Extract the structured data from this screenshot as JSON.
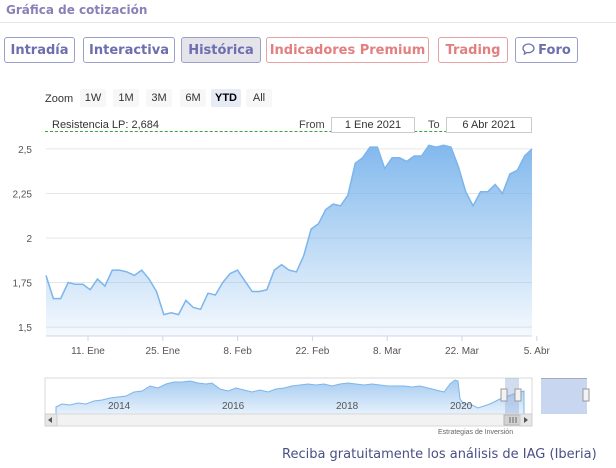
{
  "page": {
    "heading": "Gráfica de cotización",
    "footer": "Reciba gratuitamente los análisis de IAG (Iberia)"
  },
  "tabs": [
    {
      "label": "Intradía",
      "active": false,
      "color": "#6b6fae"
    },
    {
      "label": "Interactiva",
      "active": false,
      "color": "#6b6fae"
    },
    {
      "label": "Histórica",
      "active": true,
      "color": "#6b6fae"
    },
    {
      "label": "Indicadores Premium",
      "active": false,
      "color": "#e27f7f"
    },
    {
      "label": "Trading",
      "active": false,
      "color": "#e27f7f"
    },
    {
      "label": "Foro",
      "active": false,
      "icon": "speech-bubble-icon",
      "color": "#6b6fae"
    }
  ],
  "toolbar": {
    "zoom_label": "Zoom",
    "zoom_buttons": [
      "1W",
      "1M",
      "3M",
      "6M",
      "YTD",
      "All"
    ],
    "zoom_selected": "YTD",
    "resistance": "Resistencia LP: 2,684",
    "from_label": "From",
    "from_value": "1 Ene 2021",
    "to_label": "To",
    "to_value": "6 Abr 2021"
  },
  "navigator": {
    "year_labels": [
      "2014",
      "2016",
      "2018",
      "2020"
    ]
  },
  "credit": "Estrategias de Inversión",
  "chart_data": {
    "type": "area",
    "ylim": [
      1.45,
      2.55
    ],
    "yticks": [
      1.5,
      1.75,
      2,
      2.25,
      2.5
    ],
    "ytick_labels": [
      "1,5",
      "1,75",
      "2",
      "2,25",
      "2,5"
    ],
    "xtick_labels": [
      "11. Ene",
      "25. Ene",
      "8. Feb",
      "22. Feb",
      "8. Mar",
      "22. Mar",
      "5. Abr"
    ],
    "series": [
      {
        "name": "",
        "color": "#7cb5ec",
        "values": [
          1.79,
          1.66,
          1.66,
          1.75,
          1.74,
          1.74,
          1.71,
          1.77,
          1.73,
          1.82,
          1.82,
          1.81,
          1.79,
          1.82,
          1.77,
          1.7,
          1.57,
          1.58,
          1.57,
          1.65,
          1.61,
          1.6,
          1.69,
          1.68,
          1.75,
          1.8,
          1.82,
          1.76,
          1.7,
          1.7,
          1.71,
          1.82,
          1.85,
          1.82,
          1.81,
          1.9,
          2.05,
          2.08,
          2.16,
          2.19,
          2.18,
          2.24,
          2.42,
          2.45,
          2.51,
          2.51,
          2.39,
          2.45,
          2.45,
          2.43,
          2.46,
          2.46,
          2.52,
          2.51,
          2.52,
          2.51,
          2.4,
          2.26,
          2.18,
          2.26,
          2.26,
          2.3,
          2.25,
          2.36,
          2.38,
          2.46,
          2.5
        ]
      }
    ]
  }
}
